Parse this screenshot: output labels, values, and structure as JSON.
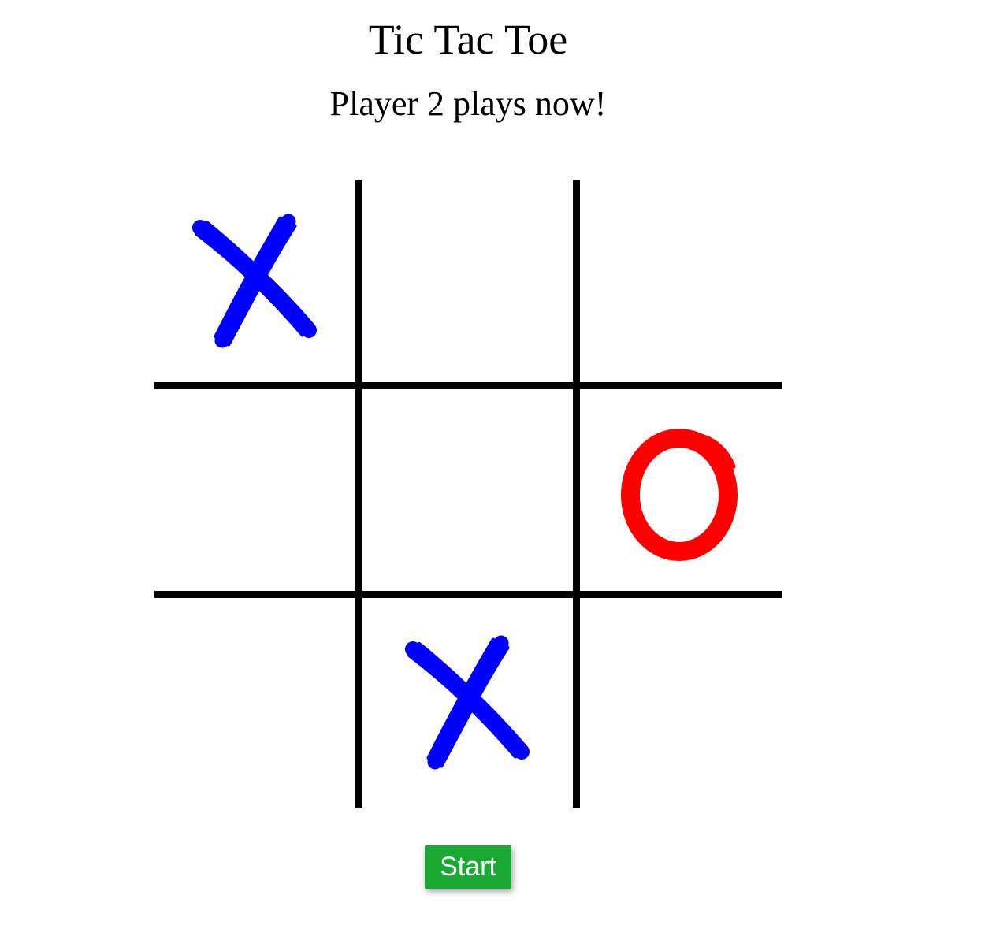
{
  "game": {
    "title": "Tic Tac Toe",
    "status": "Player 2 plays now!",
    "board": [
      "X",
      "",
      "",
      "",
      "",
      "O",
      "",
      "X",
      ""
    ],
    "colors": {
      "x": "#0000ff",
      "o": "#ff0000",
      "grid": "#000000",
      "start_button_bg": "#1aaa34"
    }
  },
  "controls": {
    "start_label": "Start"
  }
}
